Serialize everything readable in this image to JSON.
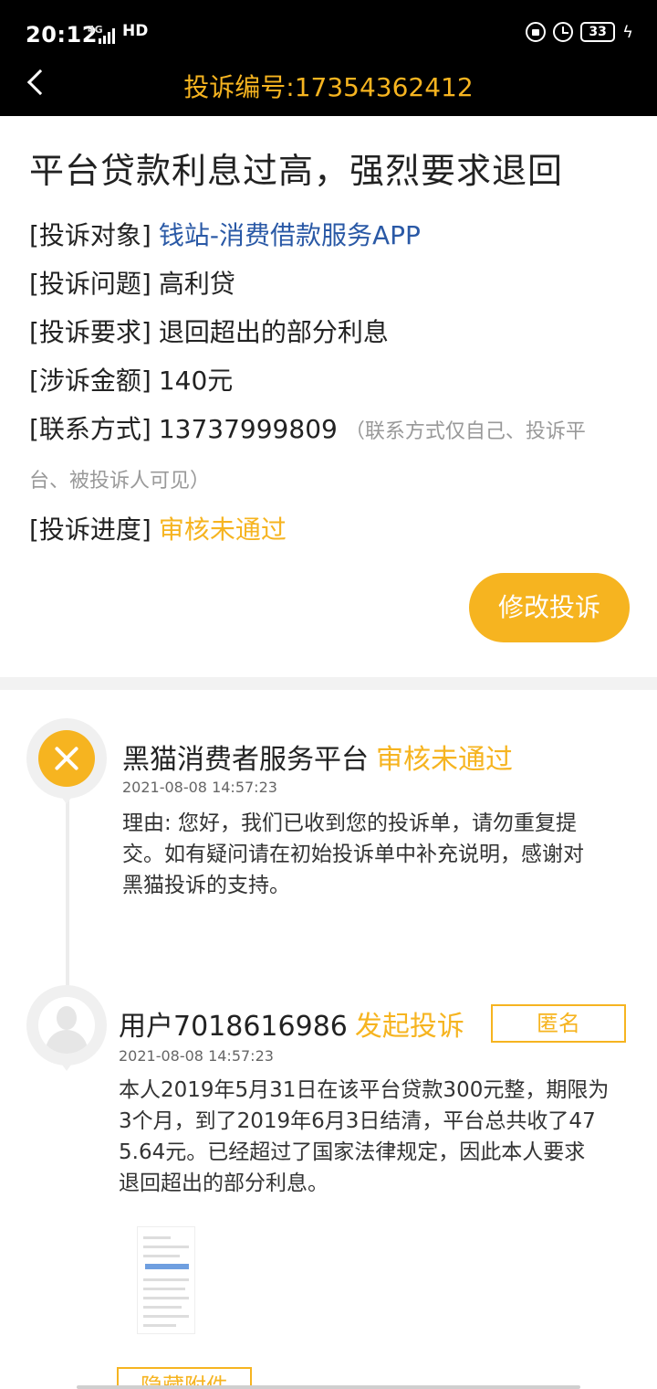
{
  "status_bar": {
    "time": "20:12",
    "network": "4G",
    "hd": "HD",
    "battery": "33"
  },
  "header": {
    "title": "投诉编号:17354362412"
  },
  "complaint": {
    "title": "平台贷款利息过高，强烈要求退回",
    "rows": [
      {
        "label": "[投诉对象]",
        "value": "钱站-消费借款服务APP"
      },
      {
        "label": "[投诉问题]",
        "value": "高利贷"
      },
      {
        "label": "[投诉要求]",
        "value": "退回超出的部分利息"
      },
      {
        "label": "[涉诉金额]",
        "value": "140元"
      },
      {
        "label": "[联系方式]",
        "value": "13737999809",
        "note": "（联系方式仅自己、投诉平",
        "note2": "台、被投诉人可见）"
      },
      {
        "label": "[投诉进度]",
        "value": "审核未通过"
      }
    ],
    "modify_button": "修改投诉"
  },
  "timeline": [
    {
      "name": "黑猫消费者服务平台",
      "status": "审核未通过",
      "time": "2021-08-08 14:57:23",
      "lines": [
        "理由: 您好，我们已收到您的投诉单，请勿重复提",
        "交。如有疑问请在初始投诉单中补充说明，感谢对",
        "黑猫投诉的支持。"
      ]
    },
    {
      "name": "用户7018616986",
      "status": "发起投诉",
      "tag": "匿名",
      "time": "2021-08-08 14:57:23",
      "lines": [
        "本人2019年5月31日在该平台贷款300元整，期限为",
        "3个月，到了2019年6月3日结清，平台总共收了47",
        "5.64元。已经超过了国家法律规定，因此本人要求",
        "退回超出的部分利息。"
      ],
      "hide_attachment": "隐藏附件"
    }
  ],
  "colors": {
    "accent": "#f6b420",
    "link": "#2a59a6",
    "header_bg": "#000000"
  }
}
